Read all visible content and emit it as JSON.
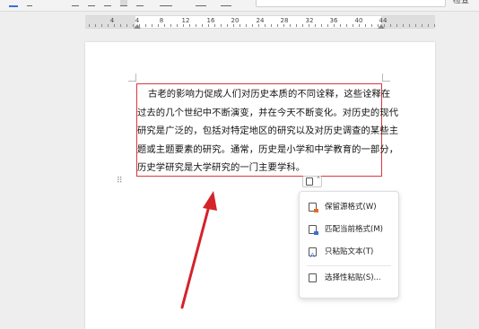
{
  "toolbar": {
    "right_text": "检查"
  },
  "ruler": {
    "ticks": [
      "4",
      "4",
      "8",
      "12",
      "16",
      "20",
      "24",
      "28",
      "32",
      "36",
      "40",
      "44"
    ]
  },
  "document": {
    "lines": [
      "古老的影响力促成人们对历史本质的不同诠释，这些诠释在",
      "过去的几个世纪中不断演变，并在今天不断变化。对历史的现代",
      "研究是广泛的，包括对特定地区的研究以及对历史调查的某些主",
      "题或主题要素的研究。通常，历史是小学和中学教育的一部分，",
      "历史学研究是大学研究的一门主要学科。"
    ]
  },
  "paste_menu": {
    "items": [
      {
        "label": "保留源格式(W)",
        "icon": "paste-keep-source-icon"
      },
      {
        "label": "匹配当前格式(M)",
        "icon": "paste-match-format-icon"
      },
      {
        "label": "只粘贴文本(T)",
        "icon": "paste-text-only-icon"
      },
      {
        "label": "选择性粘贴(S)...",
        "icon": "paste-special-icon"
      }
    ]
  },
  "colors": {
    "selection_border": "#d9363e",
    "arrow": "#d4232b"
  }
}
